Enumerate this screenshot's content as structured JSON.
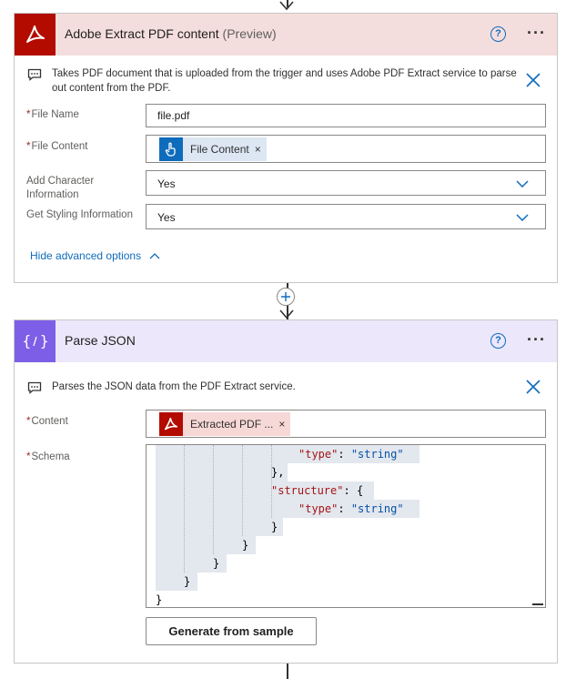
{
  "colors": {
    "adobe_header_bg": "#f4dedd",
    "adobe_icon_bg": "#b30b00",
    "json_header_bg": "#ece7fb",
    "json_icon_bg": "#7c5fe6",
    "accent": "#0f6cbd",
    "token_adobe_bg": "#f6d8d7",
    "token_trigger_bg": "#dde6f3",
    "code_highlight": "#e3e7ee"
  },
  "adobe_card": {
    "title": "Adobe Extract PDF content",
    "title_suffix": "(Preview)",
    "icon": "adobe-acrobat-icon",
    "help_glyph": "?",
    "more_glyph": "···",
    "description": "Takes PDF document that is uploaded from the trigger and uses Adobe PDF Extract service to parse out content from the PDF.",
    "fields": {
      "file_name": {
        "label": "File Name",
        "required": "*",
        "value": "file.pdf"
      },
      "file_content": {
        "label": "File Content",
        "required": "*",
        "token": "File Content",
        "token_icon": "hand-pointer-icon",
        "token_remove": "×"
      },
      "add_char_info": {
        "label": "Add Character Information",
        "value": "Yes"
      },
      "styling_info": {
        "label": "Get Styling Information",
        "value": "Yes"
      }
    },
    "advanced_link": "Hide advanced options"
  },
  "json_card": {
    "title": "Parse JSON",
    "icon": "curly-braces-icon",
    "help_glyph": "?",
    "more_glyph": "···",
    "description": "Parses the JSON data from the PDF Extract service.",
    "fields": {
      "content": {
        "label": "Content",
        "required": "*",
        "token": "Extracted PDF ...",
        "token_remove": "×"
      },
      "schema": {
        "label": "Schema",
        "required": "*"
      }
    },
    "schema_lines": [
      {
        "key": "\"type\"",
        "sep": ": ",
        "val": "\"string\""
      },
      {
        "punct": "},"
      },
      {
        "key": "\"structure\"",
        "sep": ": ",
        "punct": "{"
      },
      {
        "key": "\"type\"",
        "sep": ": ",
        "val": "\"string\""
      },
      {
        "punct": "}"
      },
      {
        "punct": "}"
      },
      {
        "punct": "}"
      },
      {
        "punct": "}"
      },
      {
        "punct": "}"
      }
    ],
    "generate_button": "Generate from sample"
  }
}
